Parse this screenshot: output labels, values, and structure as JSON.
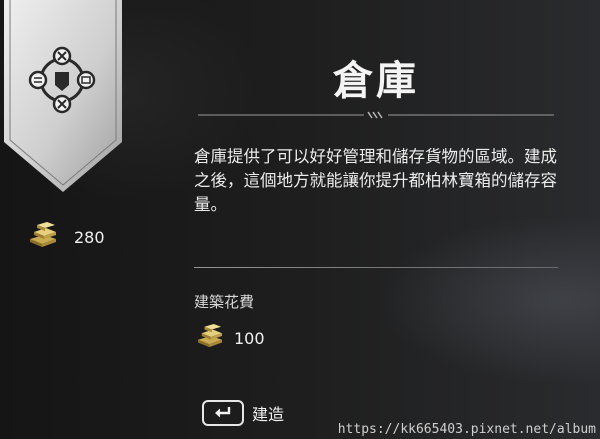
{
  "player": {
    "resource_icon": "silver-ingots-icon",
    "silver_amount": "280"
  },
  "building": {
    "title": "倉庫",
    "description": "倉庫提供了可以好好管理和儲存貨物的區域。建成之後，這個地方就能讓你提升都柏林寶箱的儲存容量。",
    "cost_label": "建築花費",
    "cost_amount": "100",
    "cost_icon": "silver-ingots-icon"
  },
  "actions": {
    "build_key_icon": "enter-key-icon",
    "build_label": "建造"
  },
  "banner": {
    "icon": "settlement-emblem-icon"
  },
  "watermark": {
    "text": "https://kk665403.pixnet.net/album"
  },
  "colors": {
    "background": "#161616",
    "text": "#ececec",
    "banner": "#d9d9d9",
    "silver": "#d8c27a"
  }
}
